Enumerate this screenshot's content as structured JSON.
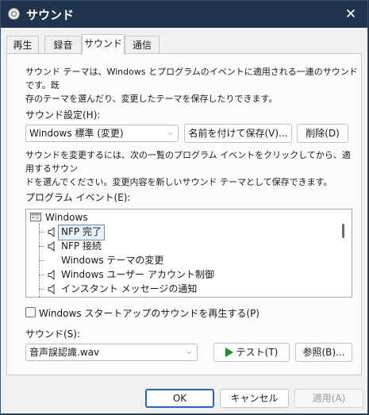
{
  "window": {
    "title": "サウンド",
    "close_glyph": "✕"
  },
  "tabs": [
    {
      "label": "再生"
    },
    {
      "label": "録音"
    },
    {
      "label": "サウンド",
      "active": true
    },
    {
      "label": "通信"
    }
  ],
  "sound_tab": {
    "description_line1": "サウンド テーマは、Windows とプログラムのイベントに適用される一連のサウンドです。既",
    "description_line2": "存のテーマを選んだり、変更したテーマを保存したりできます。",
    "scheme_label": "サウンド設定(H):",
    "scheme_value": "Windows 標準 (変更)",
    "save_as_label": "名前を付けて保存(V)...",
    "delete_label": "削除(D)",
    "instruction_line1": "サウンドを変更するには、次の一覧のプログラム イベントをクリックしてから、適用するサウン",
    "instruction_line2": "ドを選んでください。変更内容を新しいサウンド テーマとして保存できます。",
    "events_label": "プログラム イベント(E):",
    "events": {
      "root": "Windows",
      "items": [
        {
          "label": "NFP 完了",
          "has_sound": true,
          "selected": true
        },
        {
          "label": "NFP 接続",
          "has_sound": true
        },
        {
          "label": "Windows テーマの変更",
          "has_sound": false
        },
        {
          "label": "Windows ユーザー アカウント制御",
          "has_sound": true
        },
        {
          "label": "インスタント メッセージの通知",
          "has_sound": true
        }
      ]
    },
    "startup_checkbox_label": "Windows スタートアップのサウンドを再生する(P)",
    "startup_checked": false,
    "sounds_label": "サウンド(S):",
    "sound_value": "音声誤認識.wav",
    "test_label": "テスト(T)",
    "browse_label": "参照(B)..."
  },
  "footer": {
    "ok_label": "OK",
    "cancel_label": "キャンセル",
    "apply_label": "適用(A)"
  },
  "colors": {
    "titlebar": "#20344d",
    "selection_border": "#5a8fd0",
    "primary_border": "#2a63b8",
    "play_icon": "#1b8a2a"
  }
}
